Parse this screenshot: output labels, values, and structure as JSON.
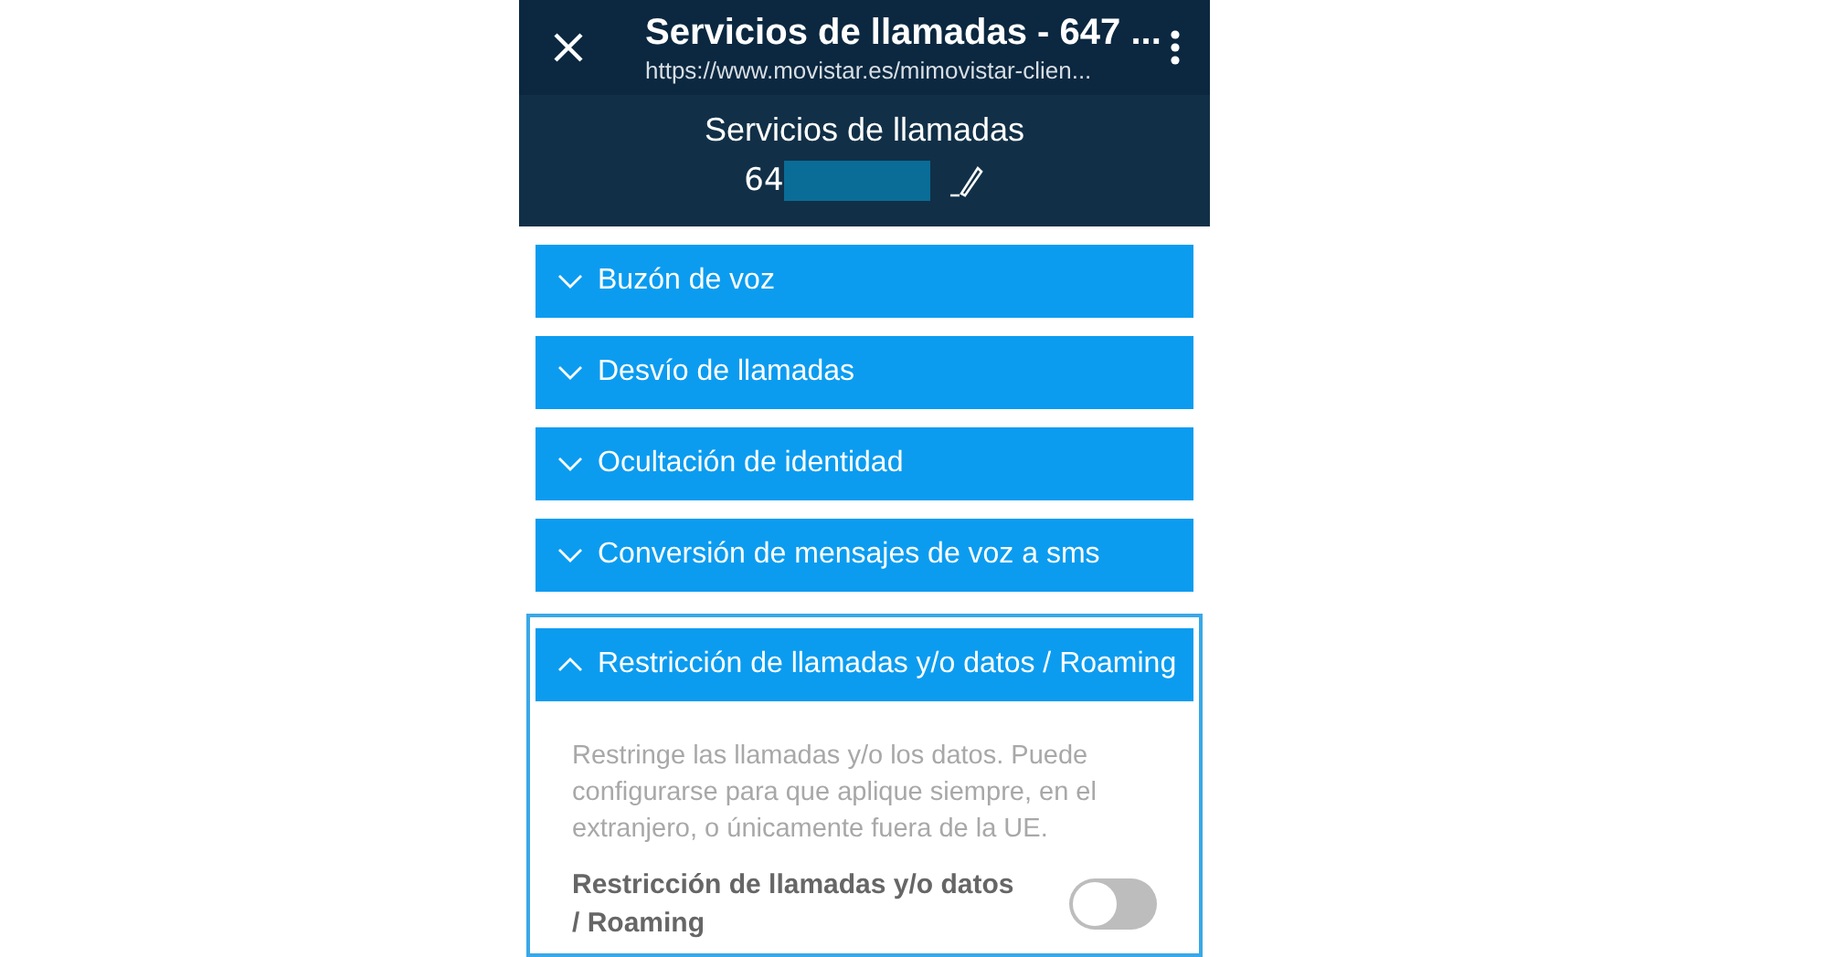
{
  "browser_bar": {
    "title": "Servicios de llamadas - 647 ...",
    "url": "https://www.movistar.es/mimovistar-clien..."
  },
  "header": {
    "title": "Servicios de llamadas",
    "number": "64",
    "redacted": true
  },
  "sections": [
    {
      "label": "Buzón de voz",
      "expanded": false
    },
    {
      "label": "Desvío de llamadas",
      "expanded": false
    },
    {
      "label": "Ocultación de identidad",
      "expanded": false
    },
    {
      "label": "Conversión de mensajes de voz a sms",
      "expanded": false
    },
    {
      "label": "Restricción de llamadas y/o datos / Roaming",
      "expanded": true,
      "focused": true,
      "description": "Restringe las llamadas y/o los datos. Puede configurarse para que aplique siempre, en el extranjero, o únicamente fuera de la UE.",
      "toggle": {
        "label": "Restricción de llamadas y/o datos / Roaming",
        "on": false
      }
    }
  ]
}
